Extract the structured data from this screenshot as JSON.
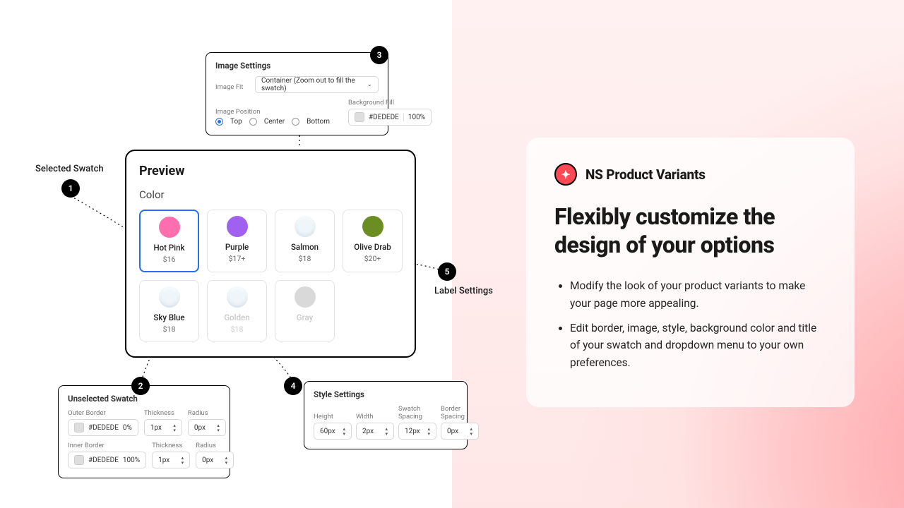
{
  "callouts": {
    "c1": {
      "num": "1",
      "label": "Selected Swatch"
    },
    "c2": {
      "num": "2",
      "label": ""
    },
    "c3": {
      "num": "3",
      "label": ""
    },
    "c4": {
      "num": "4",
      "label": ""
    },
    "c5": {
      "num": "5",
      "label": "Label Settings"
    }
  },
  "image_settings": {
    "title": "Image Settings",
    "fit_label": "Image Fit",
    "fit_value": "Container  (Zoom out to fill the swatch)",
    "pos_label": "Image Position",
    "pos_opts": {
      "top": "Top",
      "center": "Center",
      "bottom": "Bottom"
    },
    "bg_label": "Background Fill",
    "bg_value": "#DEDEDE",
    "bg_opacity": "100%"
  },
  "unselected": {
    "title": "Unselected Swatch",
    "outer_label": "Outer Border",
    "outer_color": "#DEDEDE",
    "outer_opacity": "0%",
    "inner_label": "Inner Border",
    "inner_color": "#DEDEDE",
    "inner_opacity": "100%",
    "thickness_label": "Thickness",
    "thickness_val": "1px",
    "radius_label": "Radius",
    "radius_val": "0px"
  },
  "style": {
    "title": "Style Settings",
    "height_label": "Height",
    "height_val": "60px",
    "width_label": "Width",
    "width_val": "2px",
    "spacing_label": "Swatch Spacing",
    "spacing_val": "12px",
    "bspacing_label": "Border Spacing",
    "bspacing_val": "0px"
  },
  "preview": {
    "title": "Preview",
    "option_name": "Color",
    "swatches": [
      {
        "name": "Hot Pink",
        "price": "$16",
        "color": "#ff6fb0",
        "selected": true
      },
      {
        "name": "Purple",
        "price": "$17+",
        "color": "#a060f0"
      },
      {
        "name": "Salmon",
        "price": "$18",
        "color": "img"
      },
      {
        "name": "Olive Drab",
        "price": "$20+",
        "color": "#6b8e23"
      },
      {
        "name": "Sky Blue",
        "price": "$18",
        "color": "img"
      },
      {
        "name": "Golden",
        "price": "$18",
        "color": "img",
        "dim": true
      },
      {
        "name": "Gray",
        "price": "",
        "color": "#d9d9d9",
        "dim": true
      }
    ]
  },
  "promo": {
    "brand": "NS Product Variants",
    "headline": "Flexibly customize the design of your options",
    "bullets": [
      "Modify the look of your product variants to make your page more appealing.",
      "Edit border, image, style, background color and title of your swatch and dropdown menu to your own preferences."
    ]
  }
}
